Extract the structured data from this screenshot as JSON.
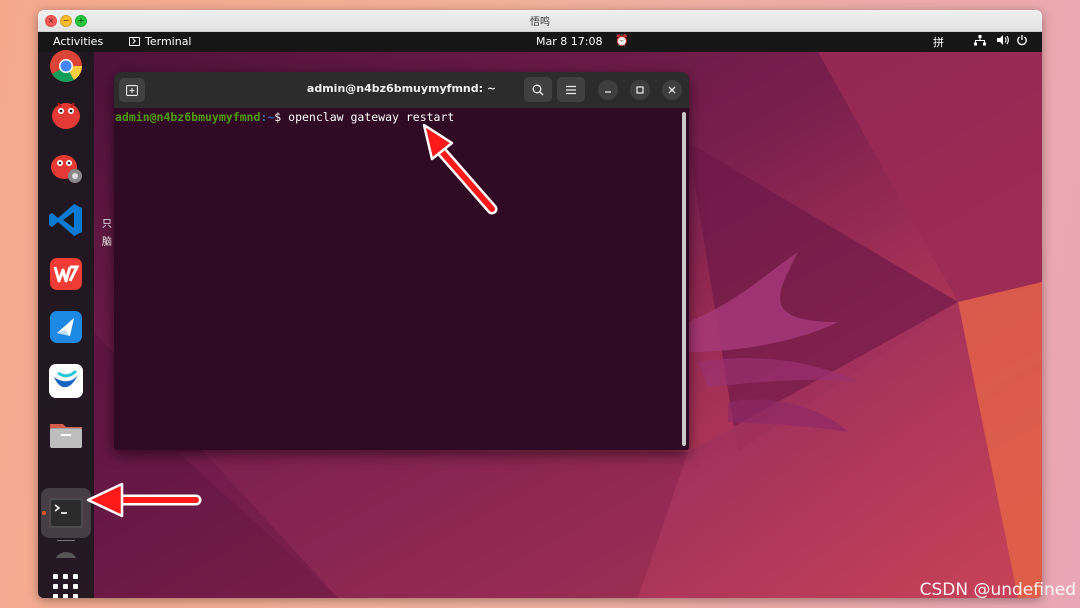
{
  "mac_window": {
    "title": "悟鸣"
  },
  "topbar": {
    "activities": "Activities",
    "app_name": "Terminal",
    "clock": "Mar 8  17:08",
    "ime": "拼"
  },
  "dock": {
    "items": [
      "chrome-icon",
      "bug-app-icon",
      "bug-settings-icon",
      "vscode-icon",
      "wps-office-icon",
      "feishu-icon",
      "lark-docs-icon",
      "files-icon",
      "terminal-icon"
    ],
    "running": "Terminal"
  },
  "desktop": {
    "partial_labels": [
      "只",
      "脑"
    ]
  },
  "terminal": {
    "title": "admin@n4bz6bmuymyfmnd: ~",
    "prompt_user": "admin@n4bz6bmuymyfmnd",
    "prompt_sep": ":",
    "prompt_path": "~",
    "prompt_symbol": "$",
    "command": "openclaw gateway restart"
  },
  "watermark": "CSDN @undefined",
  "colors": {
    "terminal_bg": "#300a24",
    "prompt_green": "#4e9a06",
    "prompt_blue": "#3465a4",
    "arrow_red": "#ff1a1a"
  }
}
